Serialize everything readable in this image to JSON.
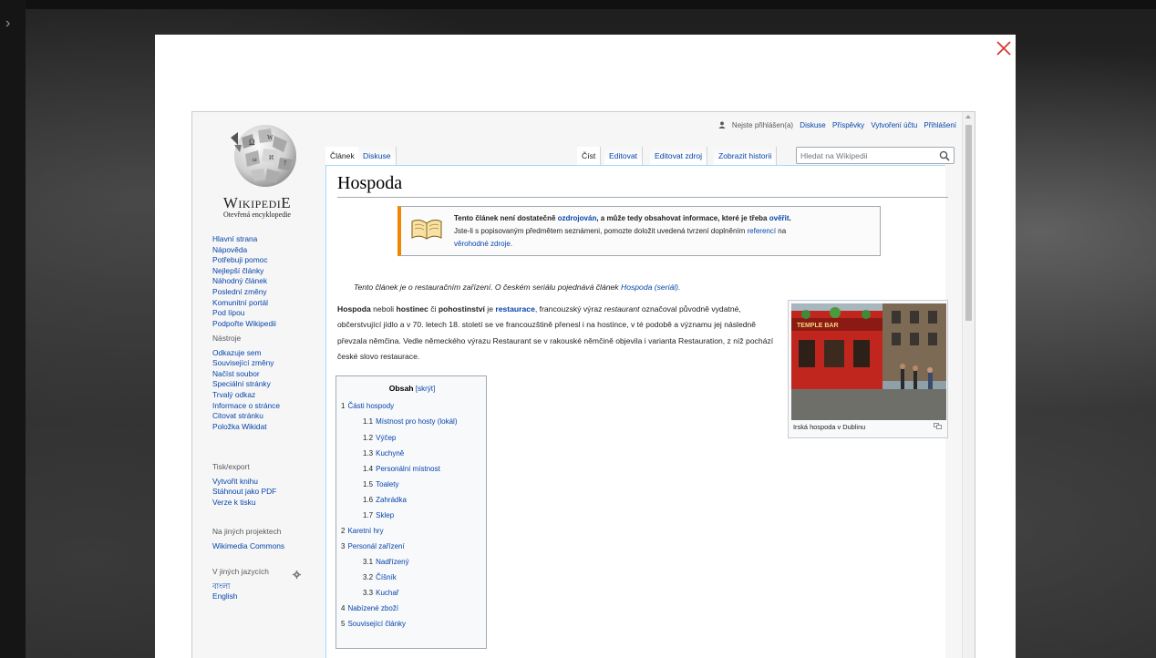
{
  "page": {
    "title": "Hospoda",
    "close_icon": "close-x-icon",
    "expand_icon": "chevron-right-icon"
  },
  "colors": {
    "close": "#d93636",
    "link": "#0645ad",
    "ambox_border": "#f28500"
  },
  "logo": {
    "wordmark": "WikipediE",
    "tagline": "Otevřená encyklopedie"
  },
  "personal": {
    "not_logged": "Nejste přihlášen(a)",
    "links": [
      "Diskuse",
      "Příspěvky",
      "Vytvoření účtu",
      "Přihlášení"
    ]
  },
  "tabs": {
    "left": [
      "Článek",
      "Diskuse"
    ],
    "right": [
      "Číst",
      "Editovat",
      "Editovat zdroj",
      "Zobrazit historii"
    ]
  },
  "search": {
    "placeholder": "Hledat na Wikipedii"
  },
  "sidebar": {
    "main": [
      "Hlavní strana",
      "Nápověda",
      "Potřebuji pomoc",
      "Nejlepší články",
      "Náhodný článek",
      "Poslední změny",
      "Komunitní portál",
      "Pod lípou",
      "Podpořte Wikipedii"
    ],
    "tools_heading": "Nástroje",
    "tools": [
      "Odkazuje sem",
      "Související změny",
      "Načíst soubor",
      "Speciální stránky",
      "Trvalý odkaz",
      "Informace o stránce",
      "Citovat stránku",
      "Položka Wikidat"
    ],
    "print_heading": "Tisk/export",
    "print": [
      "Vytvořit knihu",
      "Stáhnout jako PDF",
      "Verze k tisku"
    ],
    "projects_heading": "Na jiných projektech",
    "projects": [
      "Wikimedia Commons"
    ],
    "languages_heading": "V jiných jazycích",
    "languages": [
      "বাংলা",
      "English"
    ]
  },
  "ambox": {
    "line1_a": "Tento článek není dostatečně ",
    "line1_link": "ozdrojován",
    "line1_b": ", a může tedy obsahovat informace, které je třeba ",
    "line1_link2": "ověřit",
    "line1_c": ".",
    "line2_a": "Jste-li s popisovaným předmětem seznámeni, pomozte doložit uvedená tvrzení doplněním ",
    "line2_link": "referencí",
    "line2_b": " na",
    "line3_link": "věrohodné zdroje",
    "line3_b": "."
  },
  "hatnote": {
    "text": "Tento článek je o restauračním zařízení. O českém seriálu pojednává článek ",
    "link": "Hospoda (seriál)",
    "end": "."
  },
  "paragraph": {
    "w1": "Hospoda",
    "t1": " neboli ",
    "w2": "hostinec",
    "t2": " či ",
    "w3": "pohostinství",
    "t3": " je ",
    "link": "restaurace",
    "t4": ", francouzský výraz ",
    "i1": "restaurant",
    "t5": " označoval původně vydatné, občerstvující jídlo a v 70. letech 18. století se ve francouzštině přenesl i na hostince, v té podobě a významu jej následně převzala němčina. Vedle německého výrazu Restaurant se v rakouské němčině objevila i varianta Restauration, z níž pochází české slovo restaurace."
  },
  "thumb": {
    "caption": "Irská hospoda v Dublinu",
    "sign_text": "TEMPLE BAR"
  },
  "toc": {
    "title": "Obsah",
    "toggle": "[skrýt]",
    "items": [
      {
        "num": "1",
        "label": "Části hospody"
      },
      {
        "num": "1.1",
        "label": "Místnost pro hosty (lokál)"
      },
      {
        "num": "1.2",
        "label": "Výčep"
      },
      {
        "num": "1.3",
        "label": "Kuchyně"
      },
      {
        "num": "1.4",
        "label": "Personální místnost"
      },
      {
        "num": "1.5",
        "label": "Toalety"
      },
      {
        "num": "1.6",
        "label": "Zahrádka"
      },
      {
        "num": "1.7",
        "label": "Sklep"
      },
      {
        "num": "2",
        "label": "Karetní hry"
      },
      {
        "num": "3",
        "label": "Personál zařízení"
      },
      {
        "num": "3.1",
        "label": "Nadřízený"
      },
      {
        "num": "3.2",
        "label": "Číšník"
      },
      {
        "num": "3.3",
        "label": "Kuchař"
      },
      {
        "num": "4",
        "label": "Nabízené zboží"
      },
      {
        "num": "5",
        "label": "Související články"
      }
    ]
  }
}
